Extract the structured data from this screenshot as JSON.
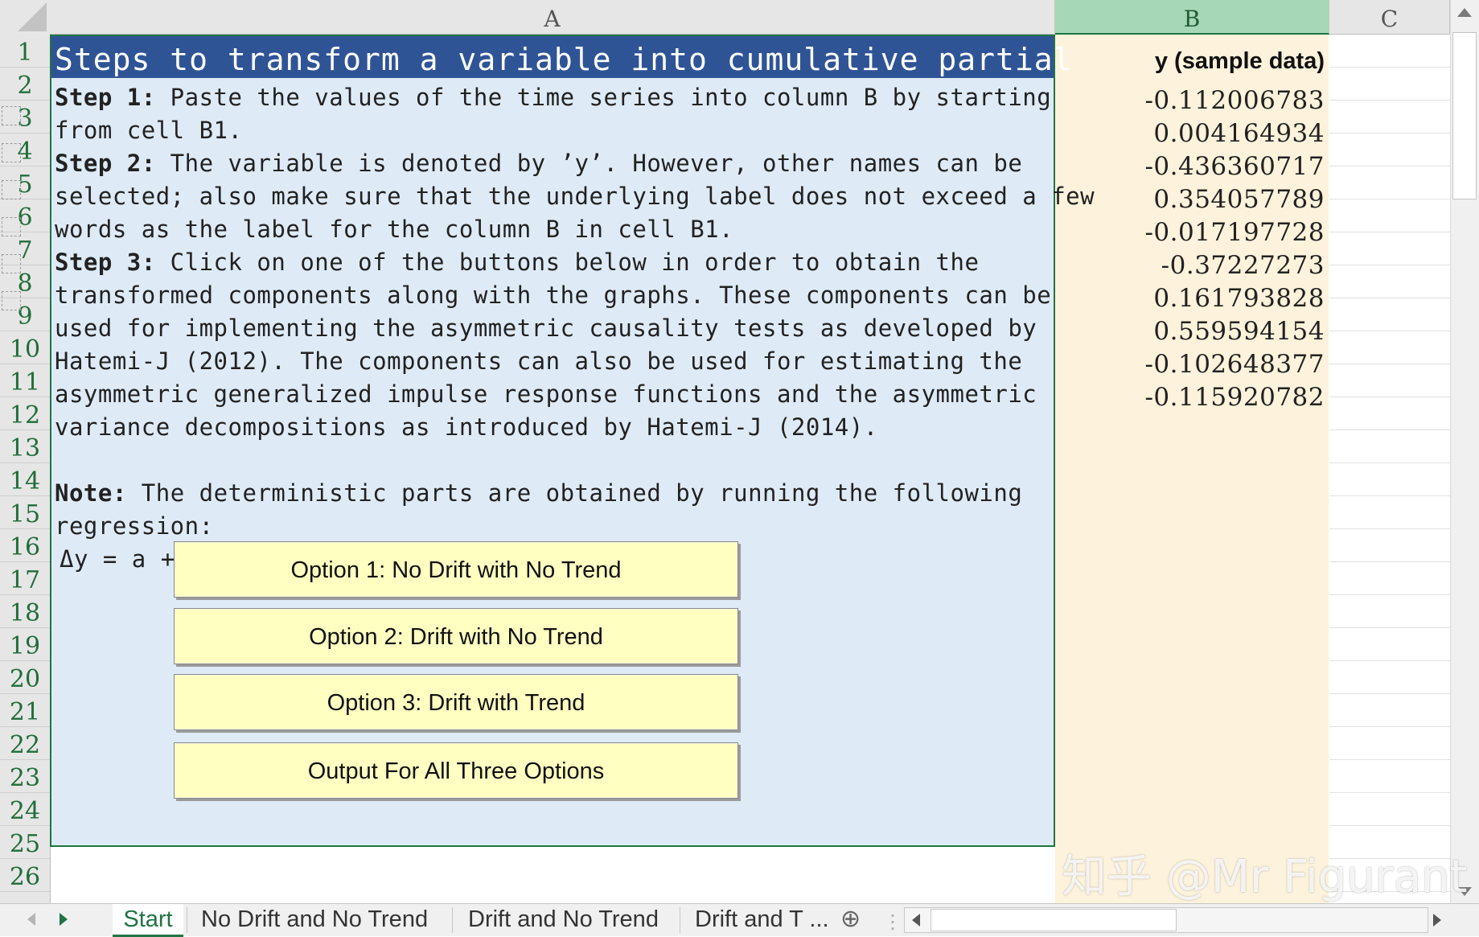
{
  "columns": [
    "A",
    "B",
    "C"
  ],
  "rows": [
    "1",
    "2",
    "3",
    "4",
    "5",
    "6",
    "7",
    "8",
    "9",
    "10",
    "11",
    "12",
    "13",
    "14",
    "15",
    "16",
    "17",
    "18",
    "19",
    "20",
    "21",
    "22",
    "23",
    "24",
    "25",
    "26"
  ],
  "title": "Steps to transform a variable into cumulative partial",
  "instructions": {
    "step1_label": "Step 1:",
    "step1_line1": " Paste the values of the time series into column B by starting",
    "step1_line2": "from cell B1.",
    "step2_label": "Step 2:",
    "step2_line1": " The variable is denoted by ’y’. However, other names can be",
    "step2_line2": "selected; also make sure that the underlying label does not exceed a few",
    "step2_line3": "words as the label for the column B in cell B1.",
    "step3_label": "Step 3:",
    "step3_line1": " Click on one of the buttons below in order to obtain the",
    "step3_line2": "transformed components along with the graphs. These components can be",
    "step3_line3": "used for implementing the asymmetric causality tests as developed by",
    "step3_line4": "Hatemi-J (2012). The components can also be used for estimating the",
    "step3_line5": "asymmetric generalized impulse response functions and the asymmetric",
    "step3_line6": "variance decompositions as introduced by Hatemi-J (2014).",
    "note_label": "Note:",
    "note_line1": " The deterministic parts are obtained by running the following",
    "note_line2": "regression:",
    "equation": "Δy = a +"
  },
  "buttons": {
    "option1": "Option 1: No Drift with No Trend",
    "option2": "Option 2: Drift with No Trend",
    "option3": "Option 3: Drift with Trend",
    "all": "Output For All Three Options"
  },
  "column_b": {
    "header": "y (sample data)",
    "values": [
      "-0.112006783",
      "0.004164934",
      "-0.436360717",
      "0.354057789",
      "-0.017197728",
      "-0.37227273",
      "0.161793828",
      "0.559594154",
      "-0.102648377",
      "-0.115920782"
    ]
  },
  "sheet_tabs": {
    "active": "Start",
    "tab2": "No Drift and No Trend",
    "tab3": "Drift and No Trend",
    "tab4": "Drift and T ...",
    "add": "⊕"
  },
  "watermark": "知乎 @Mr Figurant",
  "colors": {
    "title_bar": "#2f5496",
    "region_fill": "#deebf7",
    "column_b_fill": "#fdf2db",
    "button_fill": "#ffffc1",
    "excel_green": "#217346"
  }
}
